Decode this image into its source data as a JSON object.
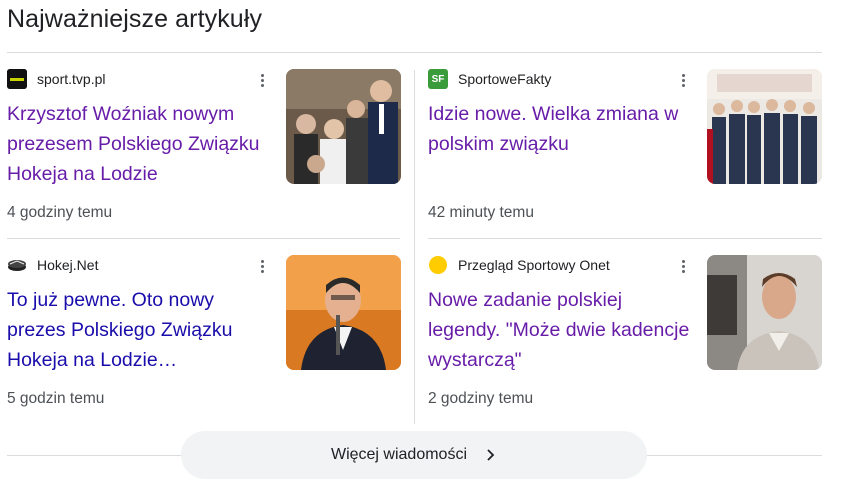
{
  "section": {
    "title": "Najważniejsze artykuły"
  },
  "articles": [
    {
      "source": "sport.tvp.pl",
      "headline": "Krzysztof Woźniak nowym prezesem Polskiego Związku Hokeja na Lodzie",
      "time": "4 godziny temu",
      "favicon_icon": "tvp-sport-logo-icon",
      "link_color": "#681da8"
    },
    {
      "source": "SportoweFakty",
      "headline": "Idzie nowe. Wielka zmiana w polskim związku",
      "time": "42 minuty temu",
      "favicon_icon": "sportowefakty-logo-icon",
      "favicon_text": "SF",
      "link_color": "#681da8"
    },
    {
      "source": "Hokej.Net",
      "headline": "To już pewne. Oto nowy prezes Polskiego Związku Hokeja na Lodzie…",
      "time": "5 godzin temu",
      "favicon_icon": "hockey-puck-icon",
      "link_color": "#1a0dab"
    },
    {
      "source": "Przegląd Sportowy Onet",
      "headline": "Nowe zadanie polskiej legendy. \"Może dwie kadencje wystarczą\"",
      "time": "2 godziny temu",
      "favicon_icon": "yellow-dot-icon",
      "link_color": "#681da8"
    }
  ],
  "more_button": {
    "label": "Więcej wiadomości",
    "icon": "chevron-right-icon"
  }
}
